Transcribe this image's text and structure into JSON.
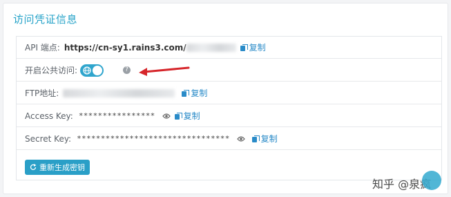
{
  "panel": {
    "title": "访问凭证信息"
  },
  "api": {
    "label": "API 端点:",
    "url": "https://cn-sy1.rains3.com/",
    "copy": "复制"
  },
  "public": {
    "label": "开启公共访问:",
    "help": "?"
  },
  "ftp": {
    "label": "FTP地址:",
    "copy": "复制"
  },
  "access": {
    "label": "Access Key:",
    "mask": "****************",
    "copy": "复制"
  },
  "secret": {
    "label": "Secret Key:",
    "mask": "********************************",
    "copy": "复制"
  },
  "regen": {
    "label": "重新生成密钥"
  },
  "watermark": {
    "text": "知乎 @泉疯"
  },
  "colors": {
    "accent": "#2a9fc7",
    "arrow": "#d6262b"
  }
}
